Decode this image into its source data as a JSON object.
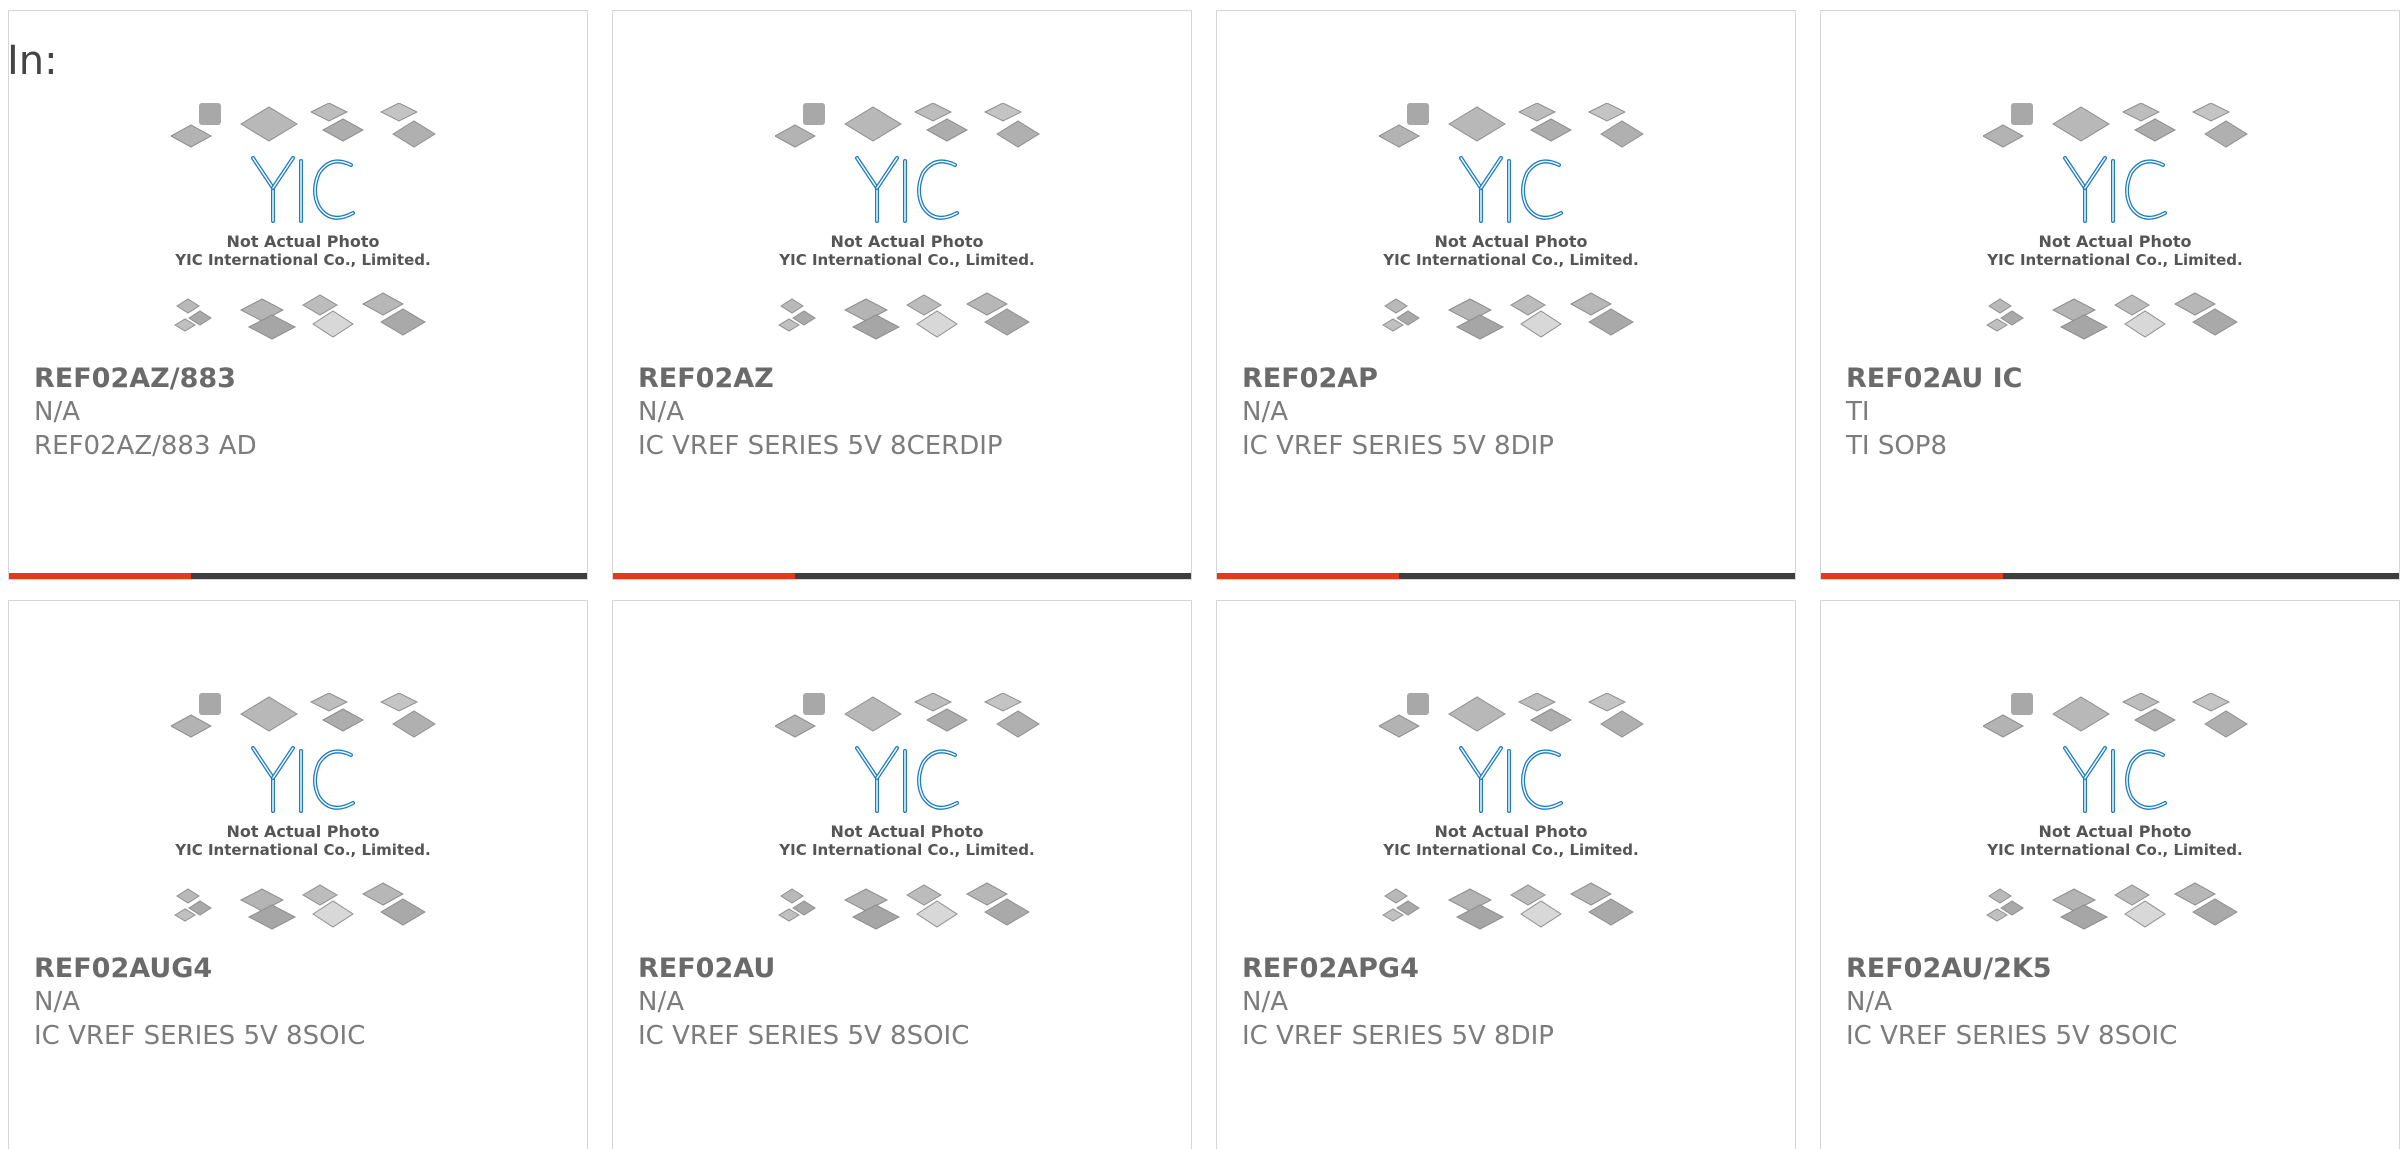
{
  "header": {
    "label": "In:"
  },
  "thumbnail": {
    "line1": "Not Actual Photo",
    "line2": "YIC International Co., Limited.",
    "brand_color": "#1d7cc0"
  },
  "accent_color": "#e23a1d",
  "products": [
    {
      "name": "REF02AZ/883",
      "manufacturer": "N/A",
      "description": "REF02AZ/883 AD"
    },
    {
      "name": "REF02AZ",
      "manufacturer": "N/A",
      "description": "IC VREF SERIES 5V 8CERDIP"
    },
    {
      "name": "REF02AP",
      "manufacturer": "N/A",
      "description": "IC VREF SERIES 5V 8DIP"
    },
    {
      "name": "REF02AU IC",
      "manufacturer": "TI",
      "description": "TI SOP8"
    },
    {
      "name": "REF02AUG4",
      "manufacturer": "N/A",
      "description": "IC VREF SERIES 5V 8SOIC"
    },
    {
      "name": "REF02AU",
      "manufacturer": "N/A",
      "description": "IC VREF SERIES 5V 8SOIC"
    },
    {
      "name": "REF02APG4",
      "manufacturer": "N/A",
      "description": "IC VREF SERIES 5V 8DIP"
    },
    {
      "name": "REF02AU/2K5",
      "manufacturer": "N/A",
      "description": "IC VREF SERIES 5V 8SOIC"
    }
  ]
}
